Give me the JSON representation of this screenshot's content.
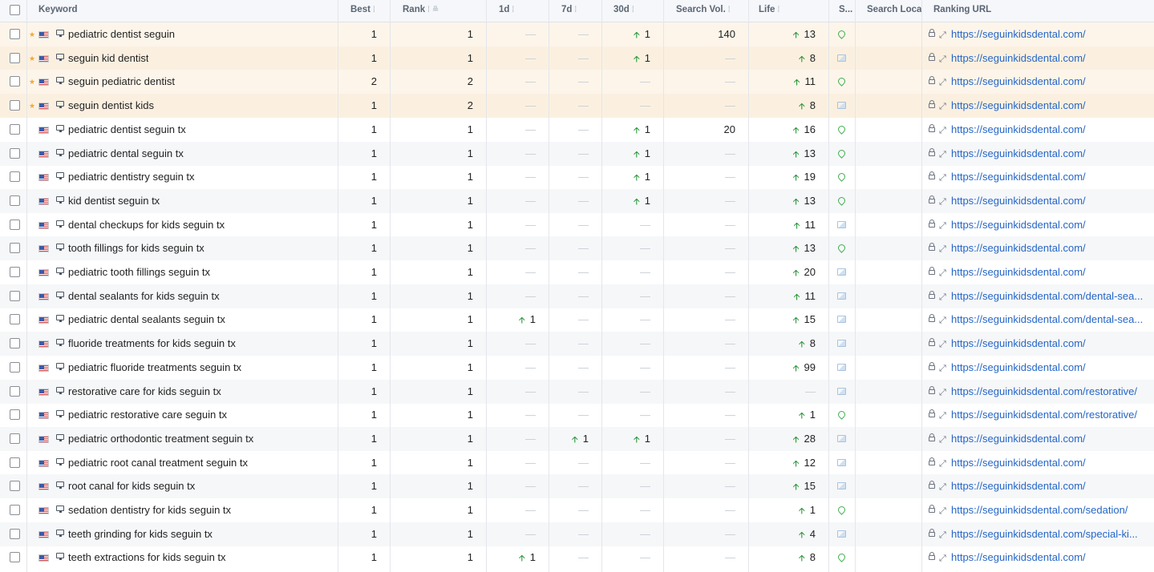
{
  "header": {
    "keyword": "Keyword",
    "best": "Best",
    "rank": "Rank",
    "d1": "1d",
    "d7": "7d",
    "d30": "30d",
    "volume": "Search Vol.",
    "life": "Life",
    "s": "S...",
    "location": "Search Locati",
    "url": "Ranking URL"
  },
  "icons": {
    "star": "star-icon",
    "flag": "us-flag-icon",
    "device": "desktop-icon",
    "pin": "map-pin-icon",
    "image": "image-icon",
    "lock": "lock-icon",
    "expand": "expand-icon",
    "up": "arrow-up-icon"
  },
  "colors": {
    "up": "#1a8f2a",
    "link": "#2566c7",
    "starred_row": "#fdf5ea",
    "pin": "#3fae4e"
  },
  "rows": [
    {
      "starred": true,
      "keyword": "pediatric dentist seguin",
      "best": "1",
      "rank": "1",
      "d1": "",
      "d7": "",
      "d30": "1",
      "volume": "140",
      "life": "13",
      "serp": "pin",
      "url": "https://seguinkidsdental.com/"
    },
    {
      "starred": true,
      "keyword": "seguin kid dentist",
      "best": "1",
      "rank": "1",
      "d1": "",
      "d7": "",
      "d30": "1",
      "volume": "",
      "life": "8",
      "serp": "image",
      "url": "https://seguinkidsdental.com/"
    },
    {
      "starred": true,
      "keyword": "seguin pediatric dentist",
      "best": "2",
      "rank": "2",
      "d1": "",
      "d7": "",
      "d30": "",
      "volume": "",
      "life": "11",
      "serp": "pin",
      "url": "https://seguinkidsdental.com/"
    },
    {
      "starred": true,
      "keyword": "seguin dentist kids",
      "best": "1",
      "rank": "2",
      "d1": "",
      "d7": "",
      "d30": "",
      "volume": "",
      "life": "8",
      "serp": "image",
      "url": "https://seguinkidsdental.com/"
    },
    {
      "starred": false,
      "keyword": "pediatric dentist seguin tx",
      "best": "1",
      "rank": "1",
      "d1": "",
      "d7": "",
      "d30": "1",
      "volume": "20",
      "life": "16",
      "serp": "pin",
      "url": "https://seguinkidsdental.com/"
    },
    {
      "starred": false,
      "keyword": "pediatric dental seguin tx",
      "best": "1",
      "rank": "1",
      "d1": "",
      "d7": "",
      "d30": "1",
      "volume": "",
      "life": "13",
      "serp": "pin",
      "url": "https://seguinkidsdental.com/"
    },
    {
      "starred": false,
      "keyword": "pediatric dentistry seguin tx",
      "best": "1",
      "rank": "1",
      "d1": "",
      "d7": "",
      "d30": "1",
      "volume": "",
      "life": "19",
      "serp": "pin",
      "url": "https://seguinkidsdental.com/"
    },
    {
      "starred": false,
      "keyword": "kid dentist seguin tx",
      "best": "1",
      "rank": "1",
      "d1": "",
      "d7": "",
      "d30": "1",
      "volume": "",
      "life": "13",
      "serp": "pin",
      "url": "https://seguinkidsdental.com/"
    },
    {
      "starred": false,
      "keyword": "dental checkups for kids seguin tx",
      "best": "1",
      "rank": "1",
      "d1": "",
      "d7": "",
      "d30": "",
      "volume": "",
      "life": "11",
      "serp": "image",
      "url": "https://seguinkidsdental.com/"
    },
    {
      "starred": false,
      "keyword": "tooth fillings for kids seguin tx",
      "best": "1",
      "rank": "1",
      "d1": "",
      "d7": "",
      "d30": "",
      "volume": "",
      "life": "13",
      "serp": "pin",
      "url": "https://seguinkidsdental.com/"
    },
    {
      "starred": false,
      "keyword": "pediatric tooth fillings seguin tx",
      "best": "1",
      "rank": "1",
      "d1": "",
      "d7": "",
      "d30": "",
      "volume": "",
      "life": "20",
      "serp": "image",
      "url": "https://seguinkidsdental.com/"
    },
    {
      "starred": false,
      "keyword": "dental sealants for kids seguin tx",
      "best": "1",
      "rank": "1",
      "d1": "",
      "d7": "",
      "d30": "",
      "volume": "",
      "life": "11",
      "serp": "image",
      "url": "https://seguinkidsdental.com/dental-sea..."
    },
    {
      "starred": false,
      "keyword": "pediatric dental sealants seguin tx",
      "best": "1",
      "rank": "1",
      "d1": "1",
      "d7": "",
      "d30": "",
      "volume": "",
      "life": "15",
      "serp": "image",
      "url": "https://seguinkidsdental.com/dental-sea..."
    },
    {
      "starred": false,
      "keyword": "fluoride treatments for kids seguin tx",
      "best": "1",
      "rank": "1",
      "d1": "",
      "d7": "",
      "d30": "",
      "volume": "",
      "life": "8",
      "serp": "image",
      "url": "https://seguinkidsdental.com/"
    },
    {
      "starred": false,
      "keyword": "pediatric fluoride treatments seguin tx",
      "best": "1",
      "rank": "1",
      "d1": "",
      "d7": "",
      "d30": "",
      "volume": "",
      "life": "99",
      "serp": "image",
      "url": "https://seguinkidsdental.com/"
    },
    {
      "starred": false,
      "keyword": "restorative care for kids seguin tx",
      "best": "1",
      "rank": "1",
      "d1": "",
      "d7": "",
      "d30": "",
      "volume": "",
      "life": "",
      "serp": "image",
      "url": "https://seguinkidsdental.com/restorative/"
    },
    {
      "starred": false,
      "keyword": "pediatric restorative care seguin tx",
      "best": "1",
      "rank": "1",
      "d1": "",
      "d7": "",
      "d30": "",
      "volume": "",
      "life": "1",
      "serp": "pin",
      "url": "https://seguinkidsdental.com/restorative/"
    },
    {
      "starred": false,
      "keyword": "pediatric orthodontic treatment seguin tx",
      "best": "1",
      "rank": "1",
      "d1": "",
      "d7": "1",
      "d30": "1",
      "volume": "",
      "life": "28",
      "serp": "image",
      "url": "https://seguinkidsdental.com/"
    },
    {
      "starred": false,
      "keyword": "pediatric root canal treatment seguin tx",
      "best": "1",
      "rank": "1",
      "d1": "",
      "d7": "",
      "d30": "",
      "volume": "",
      "life": "12",
      "serp": "image",
      "url": "https://seguinkidsdental.com/"
    },
    {
      "starred": false,
      "keyword": "root canal for kids seguin tx",
      "best": "1",
      "rank": "1",
      "d1": "",
      "d7": "",
      "d30": "",
      "volume": "",
      "life": "15",
      "serp": "image",
      "url": "https://seguinkidsdental.com/"
    },
    {
      "starred": false,
      "keyword": "sedation dentistry for kids seguin tx",
      "best": "1",
      "rank": "1",
      "d1": "",
      "d7": "",
      "d30": "",
      "volume": "",
      "life": "1",
      "serp": "pin",
      "url": "https://seguinkidsdental.com/sedation/"
    },
    {
      "starred": false,
      "keyword": "teeth grinding for kids seguin tx",
      "best": "1",
      "rank": "1",
      "d1": "",
      "d7": "",
      "d30": "",
      "volume": "",
      "life": "4",
      "serp": "image",
      "url": "https://seguinkidsdental.com/special-ki..."
    },
    {
      "starred": false,
      "keyword": "teeth extractions for kids seguin tx",
      "best": "1",
      "rank": "1",
      "d1": "1",
      "d7": "",
      "d30": "",
      "volume": "",
      "life": "8",
      "serp": "pin",
      "url": "https://seguinkidsdental.com/"
    }
  ]
}
